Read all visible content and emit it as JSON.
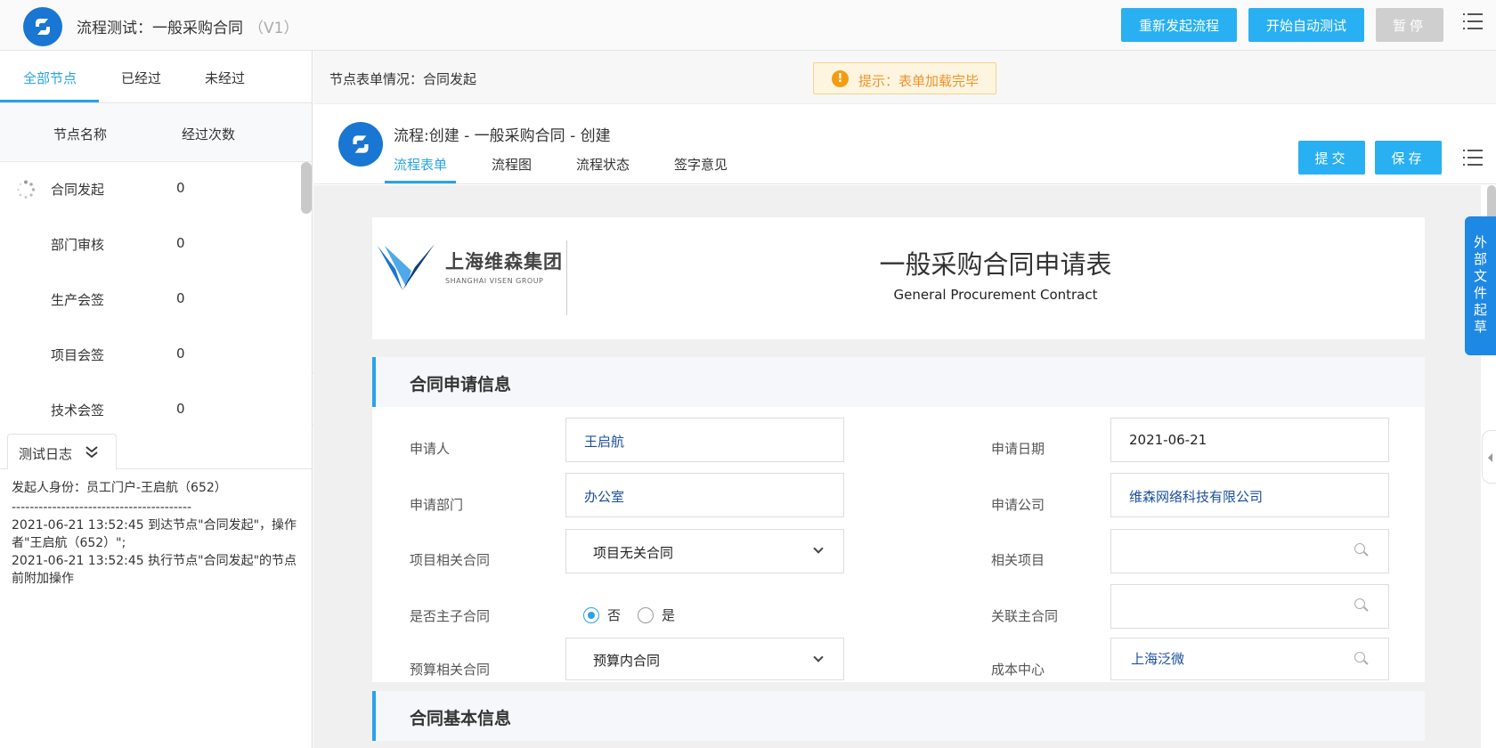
{
  "app": {
    "title": "流程测试：一般采购合同",
    "version": "（V1）"
  },
  "toolbar": {
    "restart_label": "重新发起流程",
    "autotest_label": "开始自动测试",
    "pause_label": "暂停"
  },
  "left": {
    "tabs": [
      "全部节点",
      "已经过",
      "未经过"
    ],
    "columns": {
      "name": "节点名称",
      "count": "经过次数"
    },
    "nodes": [
      {
        "name": "合同发起",
        "count": "0"
      },
      {
        "name": "部门审核",
        "count": "0"
      },
      {
        "name": "生产会签",
        "count": "0"
      },
      {
        "name": "项目会签",
        "count": "0"
      },
      {
        "name": "技术会签",
        "count": "0"
      }
    ],
    "log_tab": "测试日志",
    "log_lines": [
      "发起人身份：员工门户-王启航（652）",
      "----------------------------------------",
      "2021-06-21 13:52:45 到达节点\"合同发起\"，操作者\"王启航（652）\";",
      "2021-06-21 13:52:45 执行节点\"合同发起\"的节点前附加操作"
    ]
  },
  "main": {
    "node_form_status": "节点表单情况：合同发起",
    "tip_icon": "!",
    "tip": "提示：表单加载完毕"
  },
  "workflow": {
    "title": "流程:创建 - 一般采购合同 - 创建",
    "tabs": [
      "流程表单",
      "流程图",
      "流程状态",
      "签字意见"
    ],
    "submit_label": "提交",
    "save_label": "保存"
  },
  "side_tab": "外部文件起草",
  "form": {
    "company_cn": "上海维森集团",
    "company_en": "SHANGHAI VISEN GROUP",
    "title": "一般采购合同申请表",
    "subtitle": "General Procurement Contract",
    "section1": "合同申请信息",
    "section2": "合同基本信息",
    "fields": {
      "applicant_label": "申请人",
      "applicant": "王启航",
      "date_label": "申请日期",
      "date": "2021-06-21",
      "dept_label": "申请部门",
      "dept": "办公室",
      "company_label": "申请公司",
      "company": "维森网络科技有限公司",
      "project_contract_label": "项目相关合同",
      "project_contract": "项目无关合同",
      "related_project_label": "相关项目",
      "related_project": "",
      "is_main_label": "是否主子合同",
      "radio_no": "否",
      "radio_yes": "是",
      "main_contract_label": "关联主合同",
      "main_contract": "",
      "budget_label": "预算相关合同",
      "budget": "预算内合同",
      "cost_center_label": "成本中心",
      "cost_center": "上海泛微"
    }
  },
  "colors": {
    "accent": "#29a3e8",
    "button": "#29b0f2",
    "brand": "#1976d2",
    "tip": "#f0932b"
  }
}
